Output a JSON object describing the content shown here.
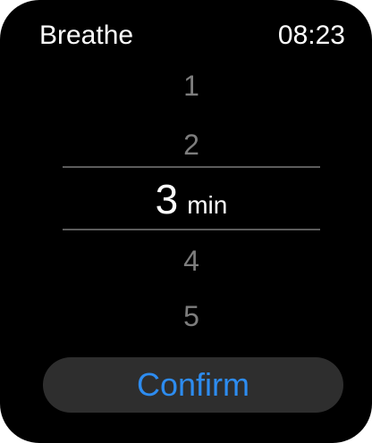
{
  "header": {
    "app_title": "Breathe",
    "time": "08:23"
  },
  "picker": {
    "options": [
      "1",
      "2",
      "3",
      "4",
      "5"
    ],
    "selected_value": "3",
    "unit": "min"
  },
  "confirm": {
    "label": "Confirm"
  },
  "colors": {
    "background": "#000000",
    "accent": "#2d8cf0",
    "button_bg": "#2e2e2e",
    "unselected_text": "#7d7d7d"
  }
}
